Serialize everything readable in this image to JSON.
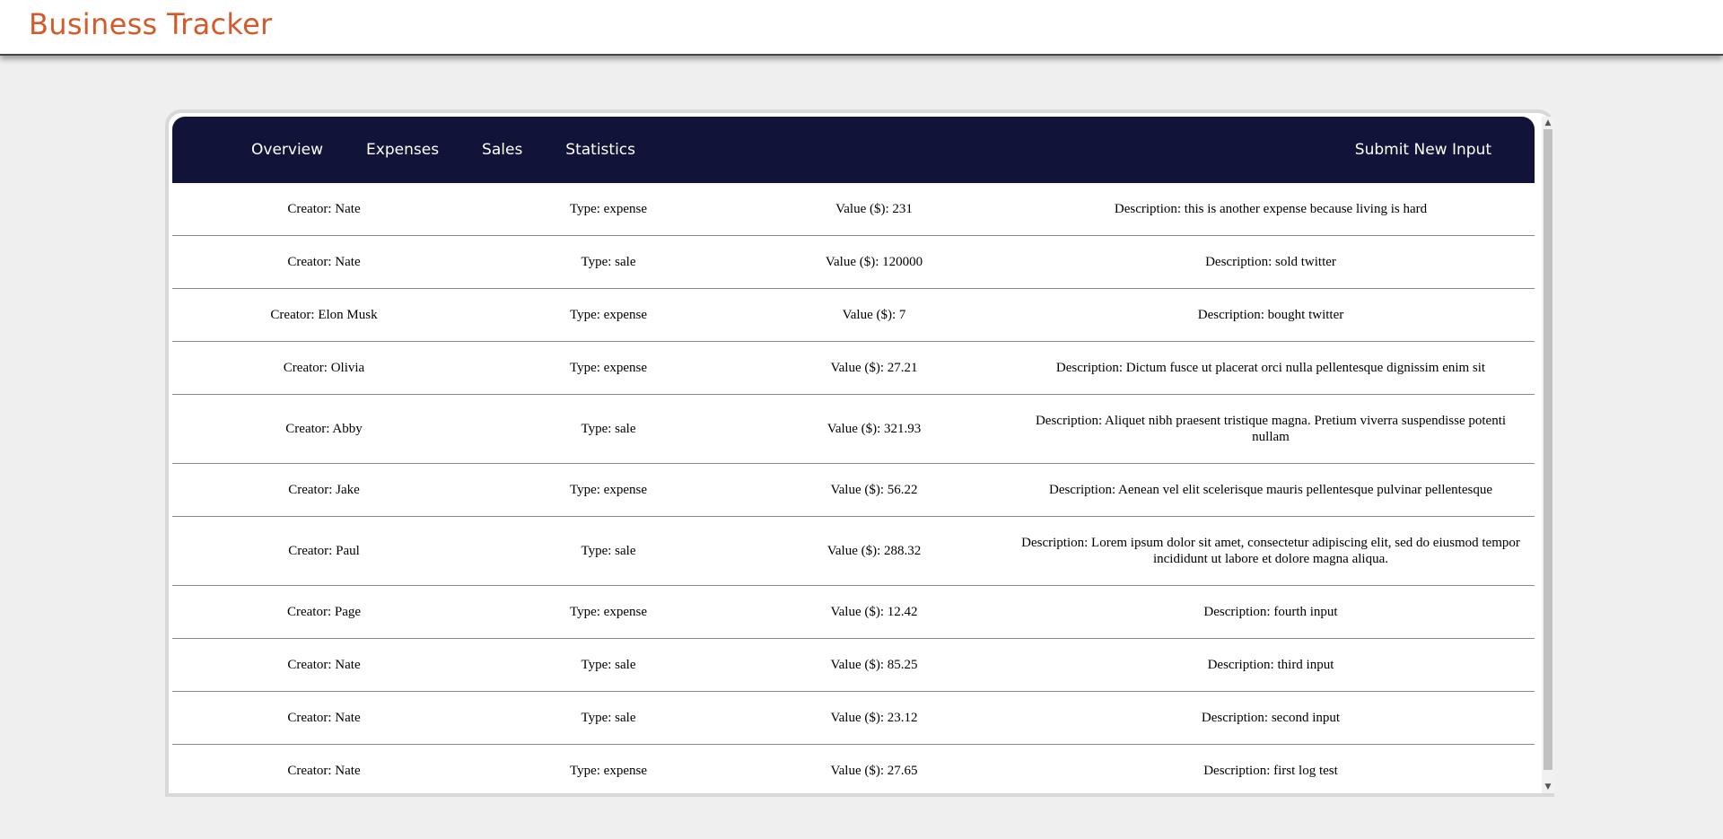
{
  "header": {
    "app_title": "Business Tracker",
    "accent_color": "#d35a2a"
  },
  "nav": {
    "tabs": [
      {
        "label": "Overview"
      },
      {
        "label": "Expenses"
      },
      {
        "label": "Sales"
      },
      {
        "label": "Statistics"
      }
    ],
    "submit_label": "Submit New Input",
    "background_color": "#121338"
  },
  "entries": [
    {
      "creator": "Creator: Nate",
      "type": "Type: expense",
      "value": "Value ($): 231",
      "description": "Description: this is another expense because living is hard"
    },
    {
      "creator": "Creator: Nate",
      "type": "Type: sale",
      "value": "Value ($): 120000",
      "description": "Description: sold twitter"
    },
    {
      "creator": "Creator: Elon Musk",
      "type": "Type: expense",
      "value": "Value ($): 7",
      "description": "Description: bought twitter"
    },
    {
      "creator": "Creator: Olivia",
      "type": "Type: expense",
      "value": "Value ($): 27.21",
      "description": "Description: Dictum fusce ut placerat orci nulla pellentesque dignissim enim sit"
    },
    {
      "creator": "Creator: Abby",
      "type": "Type: sale",
      "value": "Value ($): 321.93",
      "description": "Description: Aliquet nibh praesent tristique magna. Pretium viverra suspendisse potenti nullam"
    },
    {
      "creator": "Creator: Jake",
      "type": "Type: expense",
      "value": "Value ($): 56.22",
      "description": "Description: Aenean vel elit scelerisque mauris pellentesque pulvinar pellentesque"
    },
    {
      "creator": "Creator: Paul",
      "type": "Type: sale",
      "value": "Value ($): 288.32",
      "description": "Description: Lorem ipsum dolor sit amet, consectetur adipiscing elit, sed do eiusmod tempor incididunt ut labore et dolore magna aliqua."
    },
    {
      "creator": "Creator: Page",
      "type": "Type: expense",
      "value": "Value ($): 12.42",
      "description": "Description: fourth input"
    },
    {
      "creator": "Creator: Nate",
      "type": "Type: sale",
      "value": "Value ($): 85.25",
      "description": "Description: third input"
    },
    {
      "creator": "Creator: Nate",
      "type": "Type: sale",
      "value": "Value ($): 23.12",
      "description": "Description: second input"
    },
    {
      "creator": "Creator: Nate",
      "type": "Type: expense",
      "value": "Value ($): 27.65",
      "description": "Description: first log test"
    }
  ],
  "scrollbar": {
    "up_icon": "triangle-up-icon",
    "down_icon": "triangle-down-icon"
  }
}
